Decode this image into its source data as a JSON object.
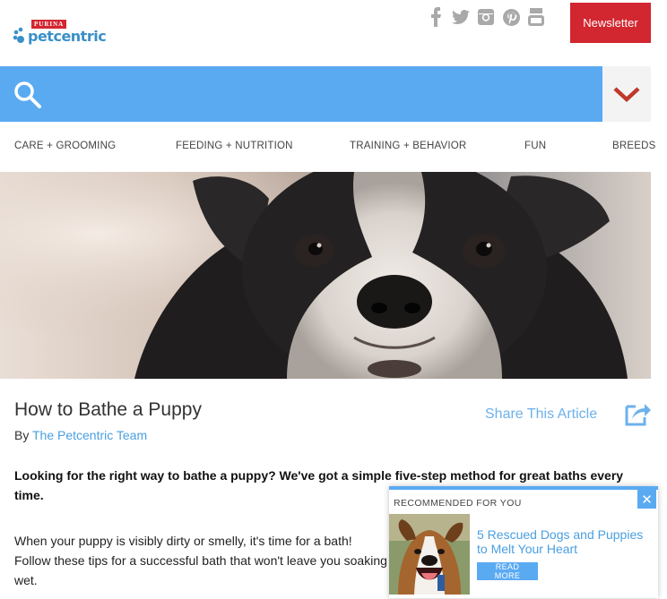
{
  "header": {
    "logo_brand": "PURINA",
    "logo_name": "petcentric",
    "social_icons": [
      "facebook-icon",
      "twitter-icon",
      "instagram-icon",
      "pinterest-icon",
      "youtube-icon"
    ],
    "newsletter_label": "Newsletter"
  },
  "search": {
    "icon": "search-icon",
    "dropdown_icon": "chevron-down-icon"
  },
  "nav": {
    "items": [
      {
        "label": "CARE + GROOMING"
      },
      {
        "label": "FEEDING + NUTRITION"
      },
      {
        "label": "TRAINING + BEHAVIOR"
      },
      {
        "label": "FUN"
      },
      {
        "label": "BREEDS"
      }
    ]
  },
  "article": {
    "title": "How to Bathe a Puppy",
    "by_prefix": "By",
    "author": "The Petcentric Team",
    "share_label": "Share This Article",
    "lede": "Looking for the right way to bathe a puppy? We've got a simple five-step method for great baths every time.",
    "paragraph": "When your puppy is visibly dirty or smelly, it's time for a bath! Follow these tips for a successful bath that won't leave you soaking wet."
  },
  "recommended": {
    "label": "RECOMMENDED FOR YOU",
    "close": "✕",
    "title": "5 Rescued Dogs and Puppies to Melt Your Heart",
    "button": "READ MORE"
  },
  "colors": {
    "brand_red": "#d22630",
    "accent_blue": "#5aaaf2",
    "link_blue": "#4a9fe0"
  }
}
